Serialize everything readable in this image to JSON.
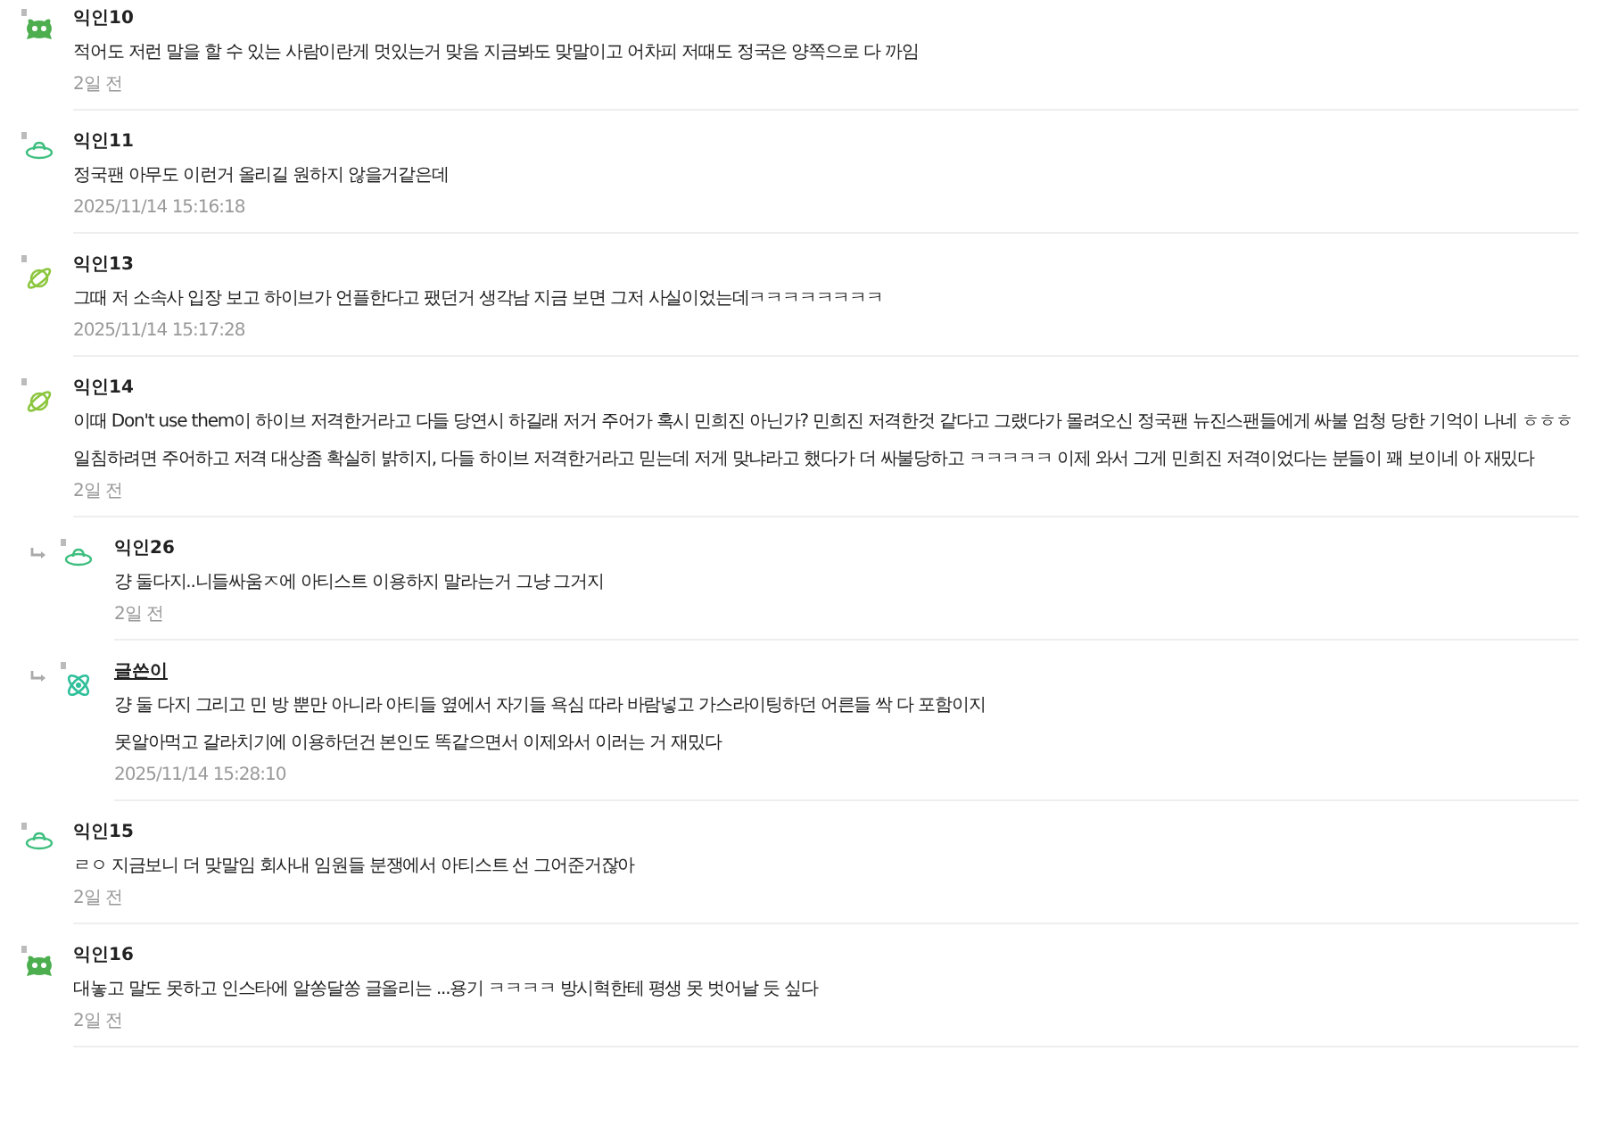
{
  "comments": [
    {
      "reply": false,
      "kind": "monster",
      "author": "익인10",
      "is_writer": false,
      "lines": [
        "적어도 저런 말을 할 수 있는 사람이란게 멋있는거 맞음 지금봐도 맞말이고 어차피 저때도 정국은 양쪽으로 다 까임"
      ],
      "time": "2일 전"
    },
    {
      "reply": false,
      "kind": "ufo",
      "author": "익인11",
      "is_writer": false,
      "lines": [
        "정국팬 아무도 이런거 올리길 원하지 않을거같은데"
      ],
      "time": "2025/11/14 15:16:18"
    },
    {
      "reply": false,
      "kind": "planet",
      "author": "익인13",
      "is_writer": false,
      "lines": [
        "그때 저 소속사 입장 보고 하이브가 언플한다고 팼던거 생각남 지금 보면 그저 사실이었는데ㅋㅋㅋㅋㅋㅋㅋㅋ"
      ],
      "time": "2025/11/14 15:17:28"
    },
    {
      "reply": false,
      "kind": "planet",
      "author": "익인14",
      "is_writer": false,
      "lines": [
        "이때 Don't use them이 하이브 저격한거라고 다들 당연시 하길래 저거 주어가 혹시 민희진 아닌가? 민희진 저격한것 같다고 그랬다가 몰려오신 정국팬 뉴진스팬들에게 싸불 엄청 당한 기억이 나네 ㅎㅎㅎ 일침하려면 주어하고 저격 대상좀 확실히 밝히지, 다들 하이브 저격한거라고 믿는데 저게 맞냐라고 했다가 더 싸불당하고 ㅋㅋㅋㅋㅋ 이제 와서 그게 민희진 저격이었다는 분들이 꽤 보이네 아 재밌다"
      ],
      "time": "2일 전"
    },
    {
      "reply": true,
      "kind": "ufo",
      "author": "익인26",
      "is_writer": false,
      "lines": [
        "걍 둘다지..니들싸움ㅈ에 아티스트 이용하지 말라는거 그냥 그거지"
      ],
      "time": "2일 전"
    },
    {
      "reply": true,
      "kind": "atom",
      "author": "글쓴이",
      "is_writer": true,
      "lines": [
        "걍 둘 다지 그리고 민 방 뿐만 아니라 아티들 옆에서 자기들 욕심 따라 바람넣고 가스라이팅하던 어른들 싹 다 포함이지",
        "못알아먹고 갈라치기에 이용하던건 본인도 똑같으면서 이제와서 이러는 거 재밌다"
      ],
      "time": "2025/11/14 15:28:10"
    },
    {
      "reply": false,
      "kind": "ufo",
      "author": "익인15",
      "is_writer": false,
      "lines": [
        "ㄹㅇ 지금보니 더 맞말임 회사내 임원들 분쟁에서 아티스트 선 그어준거잖아"
      ],
      "time": "2일 전"
    },
    {
      "reply": false,
      "kind": "monster",
      "author": "익인16",
      "is_writer": false,
      "lines": [
        "대놓고 말도 못하고 인스타에 알쏭달쏭 글올리는 ...용기 ㅋㅋㅋㅋ 방시혁한테 평생 못 벗어날 듯 싶다"
      ],
      "time": "2일 전"
    }
  ]
}
